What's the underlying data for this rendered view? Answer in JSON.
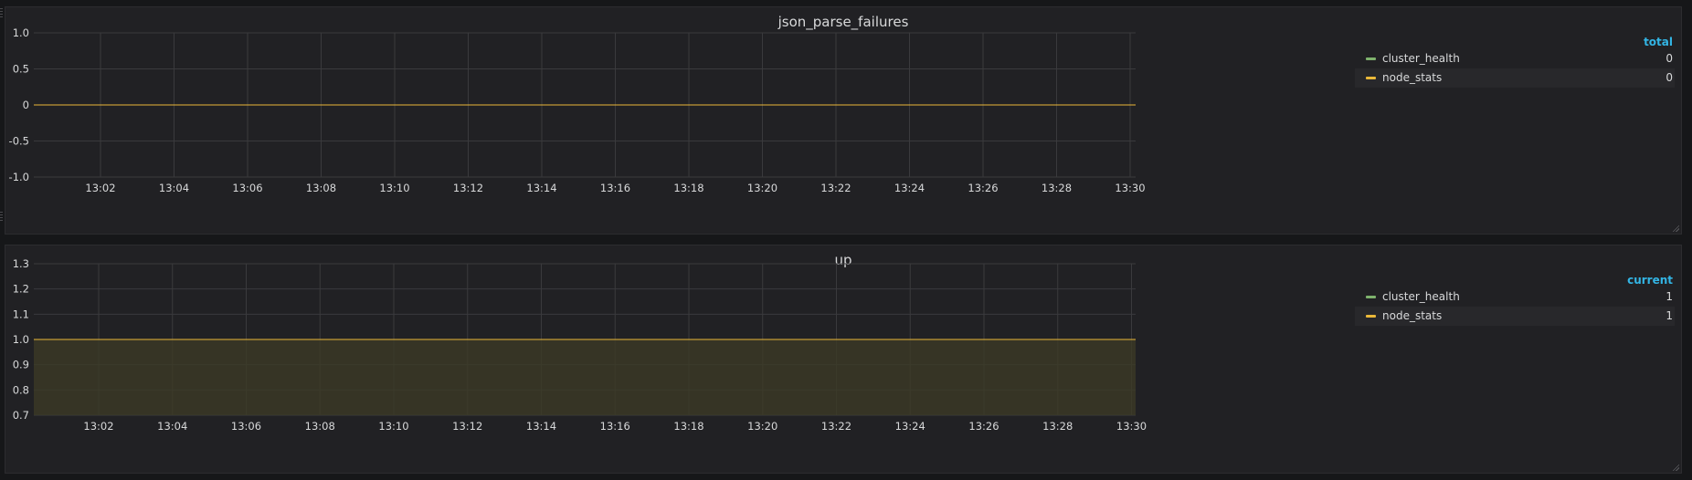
{
  "colors": {
    "cluster_health": "#7eb26d",
    "node_stats": "#eab839",
    "grid": "#3a3a3d",
    "area_fill": "#3d3a26"
  },
  "chart_data": [
    {
      "type": "line",
      "title": "json_parse_failures",
      "x": [
        "13:02",
        "13:04",
        "13:06",
        "13:08",
        "13:10",
        "13:12",
        "13:14",
        "13:16",
        "13:18",
        "13:20",
        "13:22",
        "13:24",
        "13:26",
        "13:28",
        "13:30"
      ],
      "ylim": [
        -1.0,
        1.0
      ],
      "yticks": [
        "1.0",
        "0.5",
        "0",
        "-0.5",
        "-1.0"
      ],
      "ytick_values": [
        1.0,
        0.5,
        0,
        -0.5,
        -1.0
      ],
      "fill": false,
      "grid": true,
      "legend_position": "right",
      "legend_header": "total",
      "series": [
        {
          "name": "cluster_health",
          "value": 0,
          "legend_value": "0",
          "color_key": "cluster_health"
        },
        {
          "name": "node_stats",
          "value": 0,
          "legend_value": "0",
          "color_key": "node_stats"
        }
      ]
    },
    {
      "type": "area",
      "title": "up",
      "x": [
        "13:02",
        "13:04",
        "13:06",
        "13:08",
        "13:10",
        "13:12",
        "13:14",
        "13:16",
        "13:18",
        "13:20",
        "13:22",
        "13:24",
        "13:26",
        "13:28",
        "13:30"
      ],
      "ylim": [
        0.7,
        1.3
      ],
      "yticks": [
        "1.3",
        "1.2",
        "1.1",
        "1.0",
        "0.9",
        "0.8",
        "0.7"
      ],
      "ytick_values": [
        1.3,
        1.2,
        1.1,
        1.0,
        0.9,
        0.8,
        0.7
      ],
      "fill": true,
      "grid": true,
      "legend_position": "right",
      "legend_header": "current",
      "series": [
        {
          "name": "cluster_health",
          "value": 1,
          "legend_value": "1",
          "color_key": "cluster_health"
        },
        {
          "name": "node_stats",
          "value": 1,
          "legend_value": "1",
          "color_key": "node_stats"
        }
      ]
    }
  ]
}
